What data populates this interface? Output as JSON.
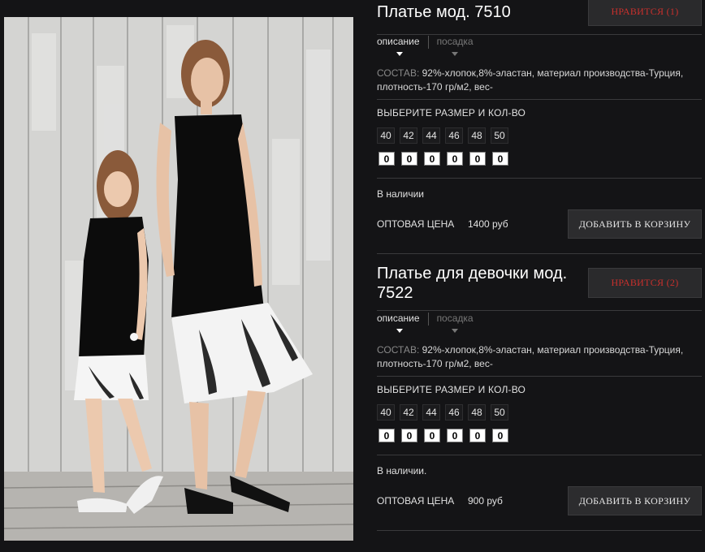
{
  "colors": {
    "background": "#141416",
    "like_accent": "#c8302c",
    "button_bg": "#2c2c2e"
  },
  "products": [
    {
      "title": "Платье мод. 7510",
      "like_label": "НРАВИТСЯ (1)",
      "tabs": [
        "описание",
        "посадка"
      ],
      "composition_label": "СОСТАВ:",
      "composition_text": "92%-хлопок,8%-эластан, материал производства-Турция, плотность-170 гр/м2, вес-",
      "size_prompt": "ВЫБЕРИТЕ РАЗМЕР И КОЛ-ВО",
      "sizes": [
        "40",
        "42",
        "44",
        "46",
        "48",
        "50"
      ],
      "quantities": [
        "0",
        "0",
        "0",
        "0",
        "0",
        "0"
      ],
      "stock": "В наличии",
      "price_label": "ОПТОВАЯ ЦЕНА",
      "price": "1400 руб",
      "cart_label": "ДОБАВИТЬ В КОРЗИНУ"
    },
    {
      "title": "Платье для девочки мод. 7522",
      "like_label": "НРАВИТСЯ (2)",
      "tabs": [
        "описание",
        "посадка"
      ],
      "composition_label": "СОСТАВ:",
      "composition_text": "92%-хлопок,8%-эластан, материал производства-Турция, плотность-170 гр/м2, вес-",
      "size_prompt": "ВЫБЕРИТЕ РАЗМЕР И КОЛ-ВО",
      "sizes": [
        "40",
        "42",
        "44",
        "46",
        "48",
        "50"
      ],
      "quantities": [
        "0",
        "0",
        "0",
        "0",
        "0",
        "0"
      ],
      "stock": "В наличии.",
      "price_label": "ОПТОВАЯ ЦЕНА",
      "price": "900 руб",
      "cart_label": "ДОБАВИТЬ В КОРЗИНУ"
    }
  ]
}
